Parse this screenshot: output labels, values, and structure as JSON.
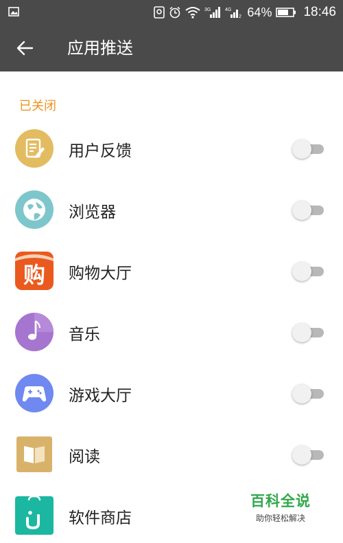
{
  "status_bar": {
    "battery": "64%",
    "time": "18:46",
    "icons": [
      "image-icon",
      "location-icon",
      "alarm-icon",
      "wifi-icon",
      "signal-3g-icon",
      "signal-4g-icon",
      "battery-icon"
    ]
  },
  "header": {
    "title": "应用推送"
  },
  "section": {
    "label": "已关闭"
  },
  "items": [
    {
      "label": "用户反馈",
      "icon": "feedback-icon",
      "color": "#e3bc62",
      "enabled": false
    },
    {
      "label": "浏览器",
      "icon": "browser-globe-icon",
      "color": "#7dc7cc",
      "enabled": false
    },
    {
      "label": "购物大厅",
      "icon": "shopping-icon",
      "color": "#ea5a1e",
      "enabled": false
    },
    {
      "label": "音乐",
      "icon": "music-note-icon",
      "color": "#a675cf",
      "enabled": false
    },
    {
      "label": "游戏大厅",
      "icon": "gamepad-icon",
      "color": "#6f89f0",
      "enabled": false
    },
    {
      "label": "阅读",
      "icon": "book-icon",
      "color": "#d9b26a",
      "enabled": false
    },
    {
      "label": "软件商店",
      "icon": "app-store-icon",
      "color": "#1bb7a1",
      "enabled": false
    }
  ],
  "watermark": {
    "title": "百科全说",
    "subtitle": "助你轻松解决"
  },
  "colors": {
    "bar": "#4a4a4a",
    "accent": "#f0921f",
    "toggle_off_track": "#b8b8b8"
  }
}
